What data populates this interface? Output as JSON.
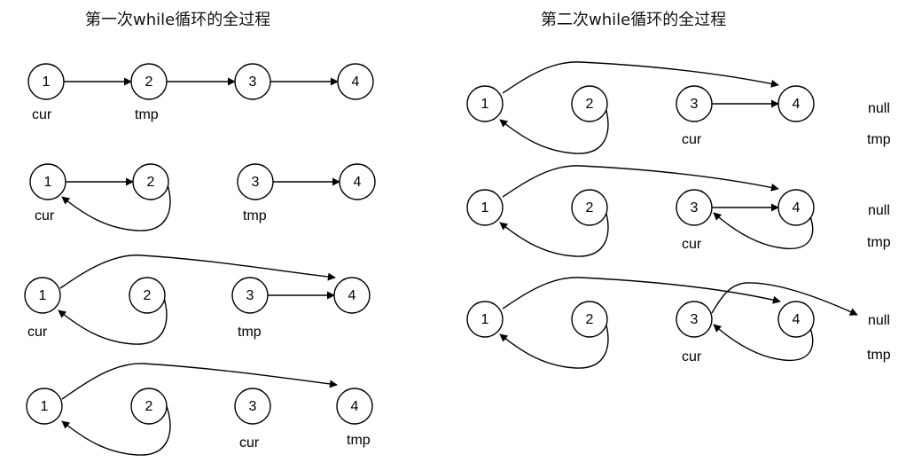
{
  "titles": {
    "left": "第一次while循环的全过程",
    "right": "第二次while循环的全过程"
  },
  "nodes": [
    "1",
    "2",
    "3",
    "4"
  ],
  "labels": {
    "cur": "cur",
    "tmp": "tmp",
    "null": "null"
  }
}
